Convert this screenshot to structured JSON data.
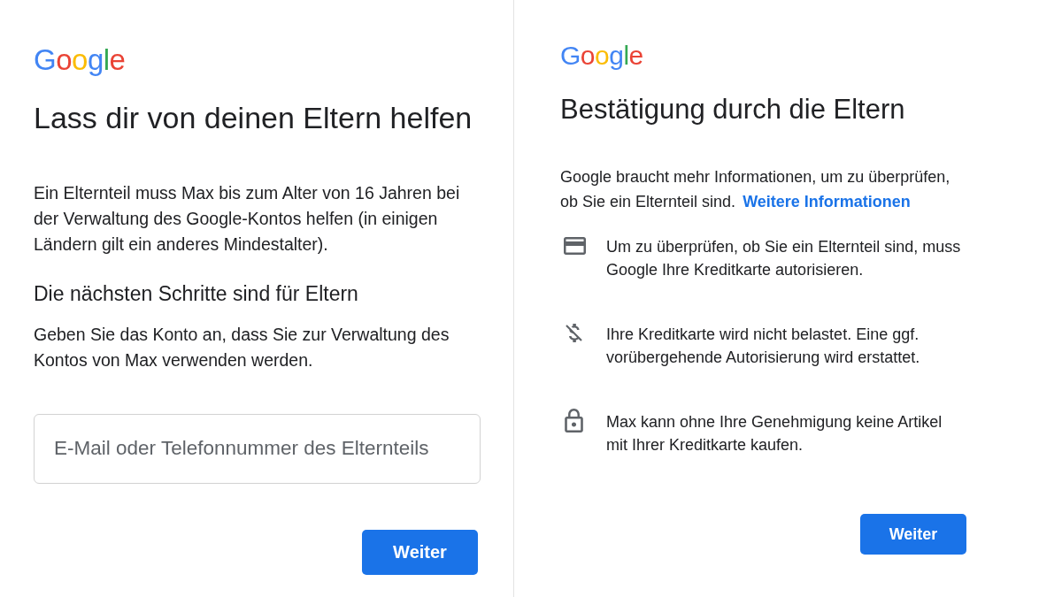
{
  "left_panel": {
    "logo": "Google",
    "title": "Lass dir von deinen Eltern helfen",
    "description": "Ein Elternteil muss Max bis zum Alter von 16 Jahren bei der Verwaltung des Google-Kontos helfen (in einigen Ländern gilt ein anderes Mindestalter).",
    "subheading": "Die nächsten Schritte sind für Eltern",
    "instruction": "Geben Sie das Konto an, dass Sie zur Verwaltung des Kontos von Max verwenden werden.",
    "email_field": {
      "placeholder": "E-Mail oder Telefonnummer des Elternteils"
    },
    "button": "Weiter"
  },
  "right_panel": {
    "logo": "Google",
    "title": "Bestätigung durch die Eltern",
    "intro": {
      "text": "Google braucht mehr Informationen, um zu überprüfen, ob Sie ein Elternteil sind.",
      "link": "Weitere Informationen"
    },
    "items": [
      {
        "kind": "card",
        "text": "Um zu überprüfen, ob Sie ein Elternteil sind, muss Google Ihre Kreditkarte autorisieren."
      },
      {
        "kind": "no-charge",
        "text": "Ihre Kreditkarte wird nicht belastet. Eine ggf. vorübergehende Autorisierung wird erstattet."
      },
      {
        "kind": "lock",
        "text": "Max kann ohne Ihre Genehmigung keine Artikel mit Ihrer Kreditkarte kaufen."
      }
    ],
    "button": "Weiter"
  }
}
